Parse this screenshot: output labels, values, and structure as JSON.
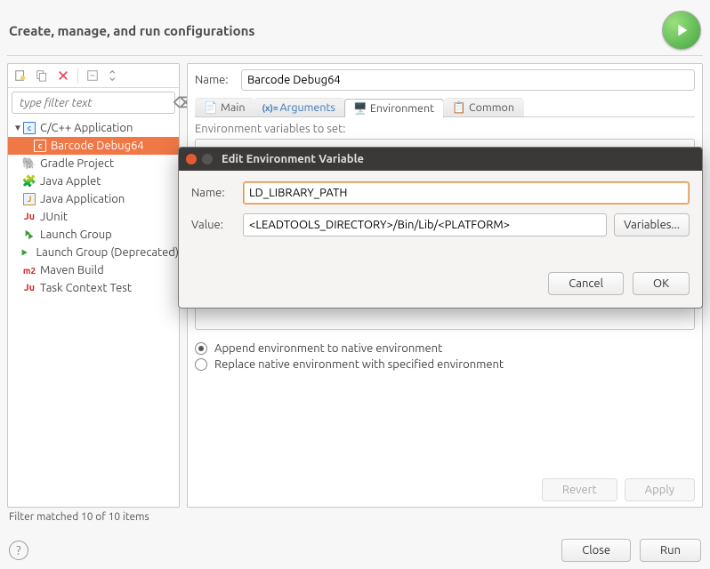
{
  "header": {
    "title": "Create, manage, and run configurations"
  },
  "sidebar": {
    "filter_placeholder": "type filter text",
    "items": [
      {
        "label": "C/C++ Application"
      },
      {
        "label": "Barcode Debug64"
      },
      {
        "label": "Gradle Project"
      },
      {
        "label": "Java Applet"
      },
      {
        "label": "Java Application"
      },
      {
        "label": "JUnit"
      },
      {
        "label": "Launch Group"
      },
      {
        "label": "Launch Group (Deprecated)"
      },
      {
        "label": "Maven Build"
      },
      {
        "label": "Task Context Test"
      }
    ],
    "footer": "Filter matched 10 of 10 items"
  },
  "main": {
    "name_label": "Name:",
    "name_value": "Barcode Debug64",
    "tabs": [
      "Main",
      "Arguments",
      "Environment",
      "Common"
    ],
    "env_section": "Environment variables to set:",
    "radios": {
      "append": "Append environment to native environment",
      "replace": "Replace native environment with specified environment"
    },
    "buttons": {
      "revert": "Revert",
      "apply": "Apply"
    }
  },
  "bottom": {
    "close": "Close",
    "run": "Run"
  },
  "modal": {
    "title": "Edit Environment Variable",
    "name_label": "Name:",
    "name_value": "LD_LIBRARY_PATH",
    "value_label": "Value:",
    "value_value": "<LEADTOOLS_DIRECTORY>/Bin/Lib/<PLATFORM>",
    "variables_btn": "Variables...",
    "cancel": "Cancel",
    "ok": "OK"
  }
}
